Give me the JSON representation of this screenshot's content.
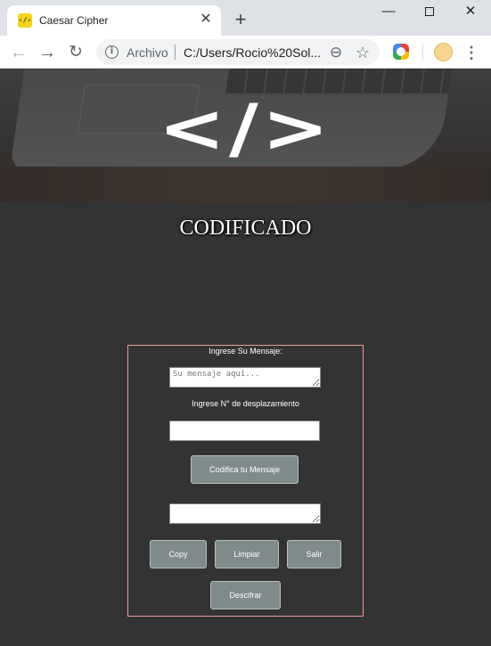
{
  "browser": {
    "tab_title": "Caesar Cipher",
    "tab_favicon": "‹/›",
    "tab_close": "✕",
    "new_tab": "+",
    "window_minimize": "—",
    "window_close": "✕",
    "nav_back": "←",
    "nav_forward": "→",
    "nav_reload": "↻",
    "omnibox_info": "i",
    "omnibox_scheme_label": "Archivo",
    "omnibox_url": "C:/Users/Rocio%20Sol...",
    "zoom_glyph": "⊖",
    "bookmark_glyph": "☆",
    "menu_glyph": "⋮",
    "icons": [
      "back-arrow-icon",
      "forward-arrow-icon",
      "reload-icon",
      "info-icon",
      "zoom-icon",
      "star-icon",
      "extension-icon",
      "profile-avatar",
      "kebab-menu-icon"
    ]
  },
  "page": {
    "hero_logo": "</>",
    "heading": "CODIFICADO",
    "form": {
      "message_label": "Ingrese Su Mensaje:",
      "message_placeholder": "Su mensaje aquí...",
      "message_value": "",
      "shift_label": "Ingrese N° de desplazamiento",
      "shift_value": "",
      "encode_button": "Codifica tu Mensaje",
      "output_value": "",
      "copy_button": "Copy",
      "clear_button": "Limpiar",
      "exit_button": "Salir",
      "decrypt_button": "Descifrar"
    },
    "colors": {
      "background": "#333333",
      "panel_border": "#f29a9a",
      "button": "#7f8b8b"
    }
  }
}
